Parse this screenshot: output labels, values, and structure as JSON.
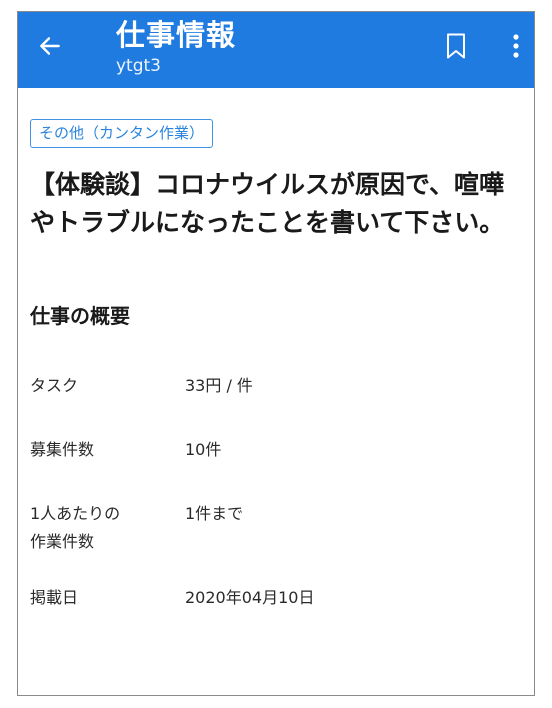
{
  "appbar": {
    "title": "仕事情報",
    "subtitle": "ytgt3",
    "back_icon": "arrow-left-icon",
    "bookmark_icon": "bookmark-outline-icon",
    "more_icon": "more-vertical-icon",
    "background_color": "#1f7be0"
  },
  "job": {
    "category": "その他（カンタン作業）",
    "title": "【体験談】コロナウイルスが原因で、喧嘩やトラブルになったことを書いて下さい。"
  },
  "overview": {
    "heading": "仕事の概要",
    "rows": [
      {
        "label": "タスク",
        "value": "33円 / 件"
      },
      {
        "label": "募集件数",
        "value": "10件"
      },
      {
        "label": "1人あたりの\n作業件数",
        "value": "1件まで"
      },
      {
        "label": "掲載日",
        "value": "2020年04月10日"
      }
    ]
  }
}
